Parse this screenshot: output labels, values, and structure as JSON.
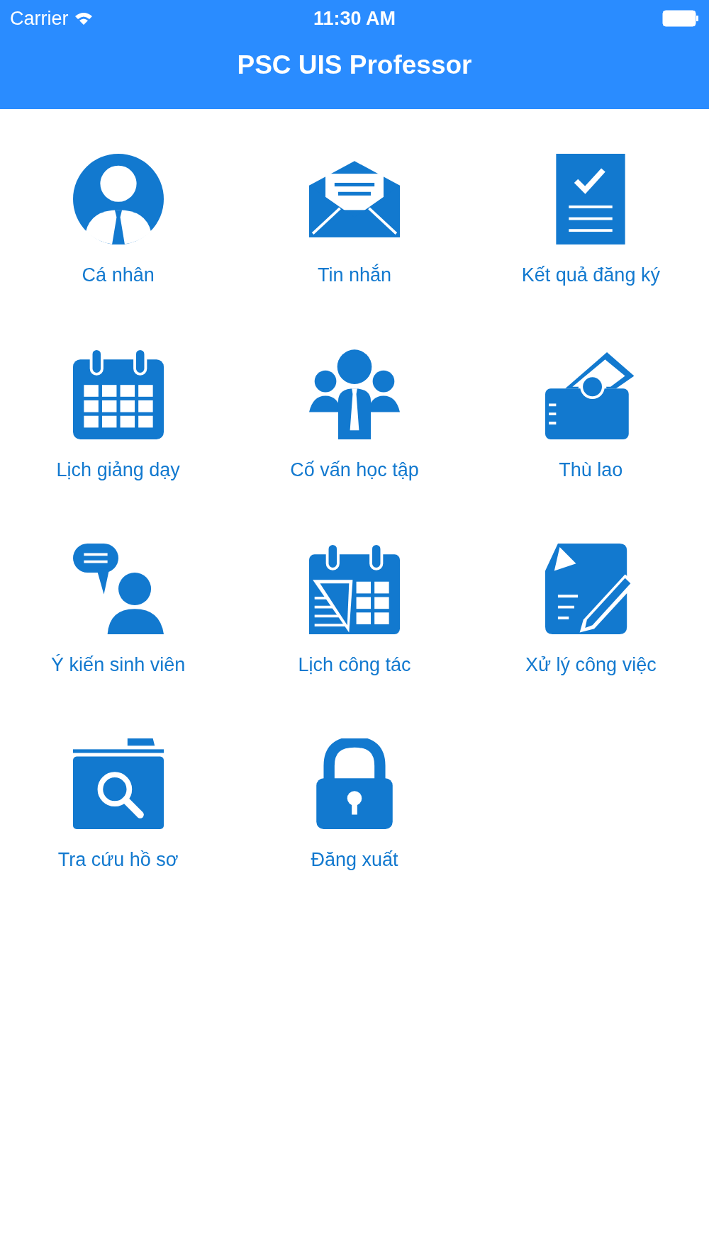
{
  "status_bar": {
    "carrier": "Carrier",
    "time": "11:30 AM"
  },
  "nav_bar": {
    "title": "PSC UIS Professor"
  },
  "menu": [
    {
      "label": "Cá nhân"
    },
    {
      "label": "Tin nhắn"
    },
    {
      "label": "Kết quả đăng ký"
    },
    {
      "label": "Lịch giảng dạy"
    },
    {
      "label": "Cố vấn học tập"
    },
    {
      "label": "Thù lao"
    },
    {
      "label": "Ý kiến sinh viên"
    },
    {
      "label": "Lịch công tác"
    },
    {
      "label": "Xử lý công việc"
    },
    {
      "label": "Tra cứu hồ sơ"
    },
    {
      "label": "Đăng xuất"
    }
  ]
}
